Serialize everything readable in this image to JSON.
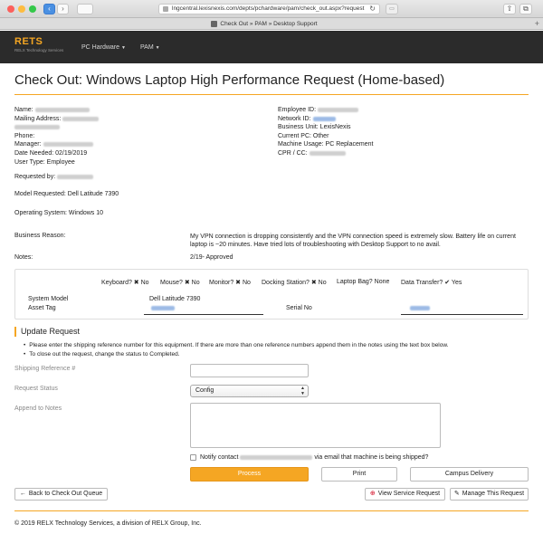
{
  "browser": {
    "url": "lngcentral.lexisnexis.com/depts/pchardware/pam/check_out.aspx?request",
    "tab_title": "Check Out » PAM » Desktop Support",
    "back_icon": "chevron-left-icon",
    "forward_icon": "chevron-right-icon"
  },
  "nav": {
    "brand": "RETS",
    "brand_sub": "RELX Technology Services",
    "items": [
      {
        "label": "PC Hardware"
      },
      {
        "label": "PAM"
      }
    ]
  },
  "page": {
    "title": "Check Out: Windows Laptop High Performance Request (Home-based)"
  },
  "details": {
    "name_label": "Name:",
    "mailing_label": "Mailing Address:",
    "phone_label": "Phone:",
    "manager_label": "Manager:",
    "date_needed": "Date Needed: 02/19/2019",
    "user_type": "User Type: Employee",
    "employee_id_label": "Employee ID:",
    "network_id_label": "Network ID:",
    "business_unit": "Business Unit: LexisNexis",
    "current_pc": "Current PC: Other",
    "machine_usage": "Machine Usage: PC Replacement",
    "cpr_label": "CPR / CC:",
    "requested_by_label": "Requested by:",
    "model_requested": "Model Requested: Dell Latitude 7390",
    "operating_system": "Operating System: Windows 10",
    "business_reason_label": "Business Reason:",
    "business_reason": "My VPN connection is dropping consistently and the VPN connection speed is extremely slow. Battery life on current laptop is ~20 minutes. Have tried lots of troubleshooting with Desktop Support to no avail.",
    "notes_label": "Notes:",
    "notes": "2/19- Approved"
  },
  "peripherals": {
    "keyboard": "Keyboard? ✖ No",
    "mouse": "Mouse? ✖ No",
    "monitor": "Monitor? ✖ No",
    "docking": "Docking Station? ✖ No",
    "laptop_bag": "Laptop Bag? None",
    "data_transfer": "Data Transfer? ✔ Yes",
    "system_model_label": "System Model",
    "system_model": "Dell Latitude 7390",
    "asset_tag_label": "Asset Tag",
    "serial_label": "Serial No"
  },
  "update": {
    "heading": "Update Request",
    "bullets": [
      "Please enter the shipping reference number for this equipment. If there are more than one reference numbers append them in the notes using the text box below.",
      "To close out the request, change the status to Completed."
    ],
    "shipping_label": "Shipping Reference #",
    "status_label": "Request Status",
    "status_value": "Config",
    "append_label": "Append to Notes",
    "notify_prefix": "Notify contact",
    "notify_suffix": "via email that machine is being shipped?"
  },
  "buttons": {
    "process": "Process",
    "print": "Print",
    "campus_delivery": "Campus Delivery",
    "back": "Back to Check Out Queue",
    "view_service": "View Service Request",
    "manage": "Manage This Request"
  },
  "footer": {
    "text": "© 2019 RELX Technology Services, a division of RELX Group, Inc."
  },
  "colors": {
    "accent": "#f5a623",
    "nav_bg": "#2b2b2b"
  }
}
